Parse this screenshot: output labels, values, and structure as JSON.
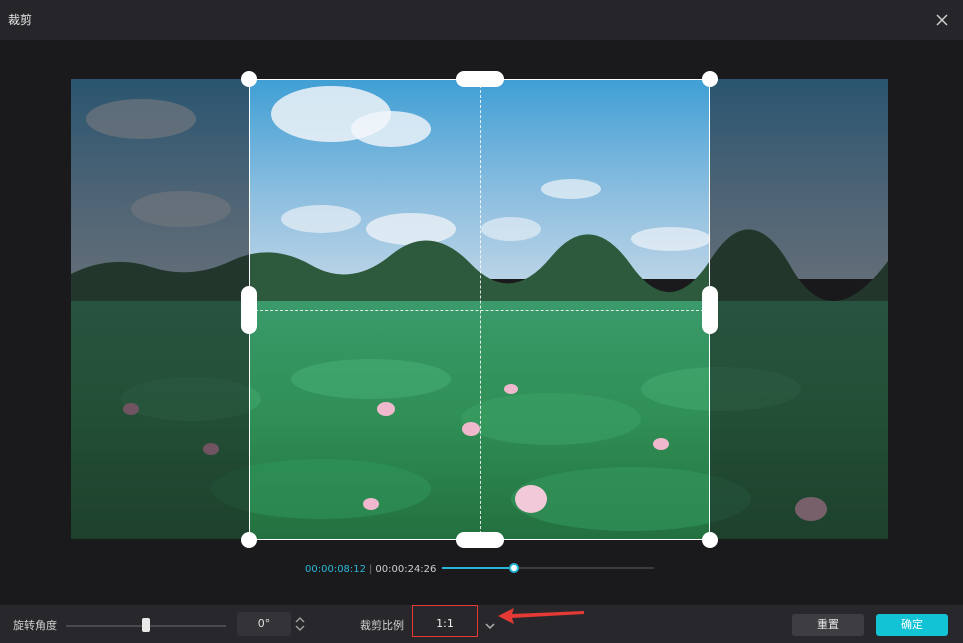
{
  "window": {
    "title": "裁剪"
  },
  "playback": {
    "current_time": "00:00:08:12",
    "separator": "|",
    "total_time": "00:00:24:26",
    "progress": 0.34
  },
  "rotation": {
    "label": "旋转角度",
    "value": "0°",
    "slider_level": 0.5
  },
  "crop_ratio": {
    "label": "裁剪比例",
    "selected": "1:1"
  },
  "buttons": {
    "reset": "重置",
    "confirm": "确定"
  },
  "colors": {
    "accent": "#12c3d6",
    "time_highlight": "#2ab6d6",
    "annotation_red": "#e53935"
  },
  "icons": {
    "close": "close-icon",
    "stepper": "up-down-stepper-icon",
    "dropdown": "chevron-down-icon",
    "annotation": "red-arrow-annotation"
  }
}
